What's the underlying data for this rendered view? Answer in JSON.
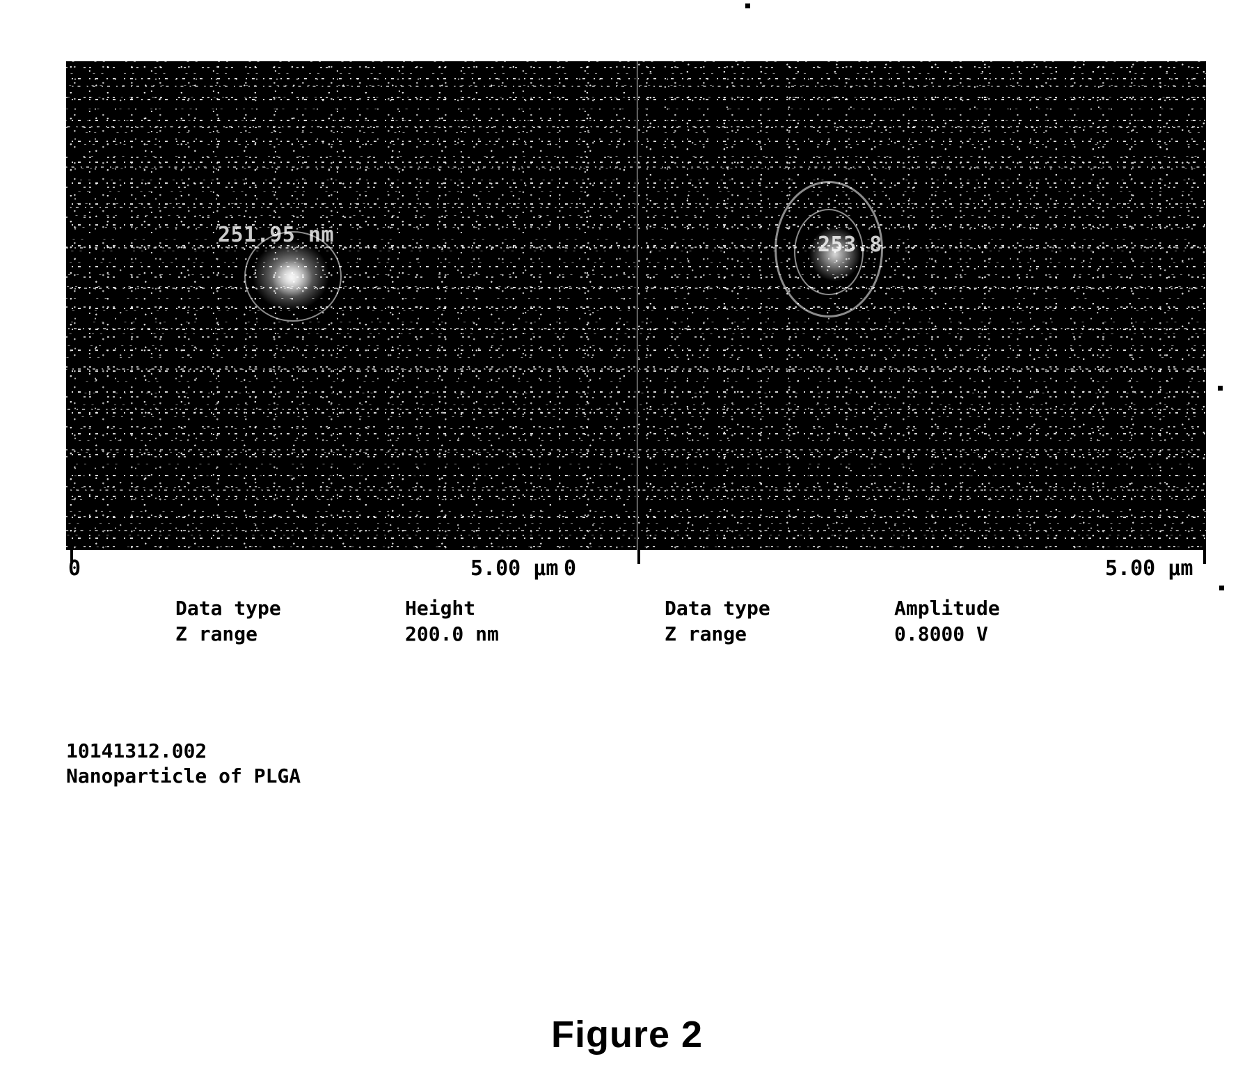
{
  "figure": {
    "caption": "Figure 2"
  },
  "scan": {
    "file_id": "10141312.002",
    "sample_description": "Nanoparticle of PLGA",
    "annotations": {
      "height_panel": "251.95 nm",
      "amplitude_panel": "253.8"
    }
  },
  "axes": {
    "left_panel": {
      "origin_label": "0",
      "end_label": "5.00 µm"
    },
    "right_panel": {
      "origin_label": "0",
      "end_label": "5.00 µm"
    }
  },
  "panels": [
    {
      "name": "height",
      "params": {
        "data_type_key": "Data type",
        "data_type_value": "Height",
        "z_range_key": "Z range",
        "z_range_value": "200.0 nm"
      }
    },
    {
      "name": "amplitude",
      "params": {
        "data_type_key": "Data type",
        "data_type_value": "Amplitude",
        "z_range_key": "Z range",
        "z_range_value": "0.8000 V"
      }
    }
  ],
  "colors": {
    "page_background": "#ffffff",
    "ink": "#000000",
    "scan_background": "#000000",
    "scan_foreground": "#ffffff"
  }
}
